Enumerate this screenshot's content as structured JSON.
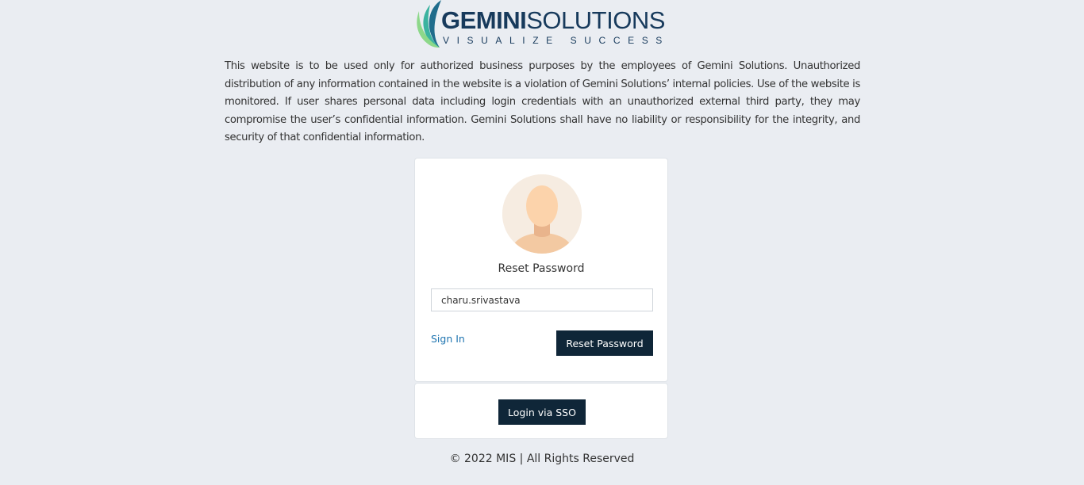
{
  "brand": {
    "name_bold": "GEMINI",
    "name_light": "SOLUTIONS",
    "tagline": "VISUALIZE SUCCESS",
    "colors": {
      "navy": "#173a5c",
      "leaf_dark": "#1f6c8c",
      "leaf_mid": "#3bb3a0",
      "leaf_light": "#8dd88a"
    }
  },
  "disclaimer": "This website is to be used only for authorized business purposes by the employees of Gemini Solutions. Unauthorized distribution of any information contained in the website is a violation of Gemini Solutions’ internal policies. Use of the website is monitored. If user shares personal data including login credentials with an unauthorized external third party, they may compromise the user’s confidential information. Gemini Solutions shall have no liability or responsibility for the integrity, and security of that confidential information.",
  "reset_card": {
    "avatar_icon": "user-avatar-icon",
    "title": "Reset Password",
    "username_value": "charu.srivastava",
    "signin_label": "Sign In",
    "reset_button_label": "Reset Password"
  },
  "sso_card": {
    "sso_button_label": "Login via SSO"
  },
  "footer": {
    "text": "© 2022 MIS | All Rights Reserved"
  },
  "theme": {
    "background": "#eaedf2",
    "button_bg": "#0f2638",
    "link": "#1e74b0"
  }
}
